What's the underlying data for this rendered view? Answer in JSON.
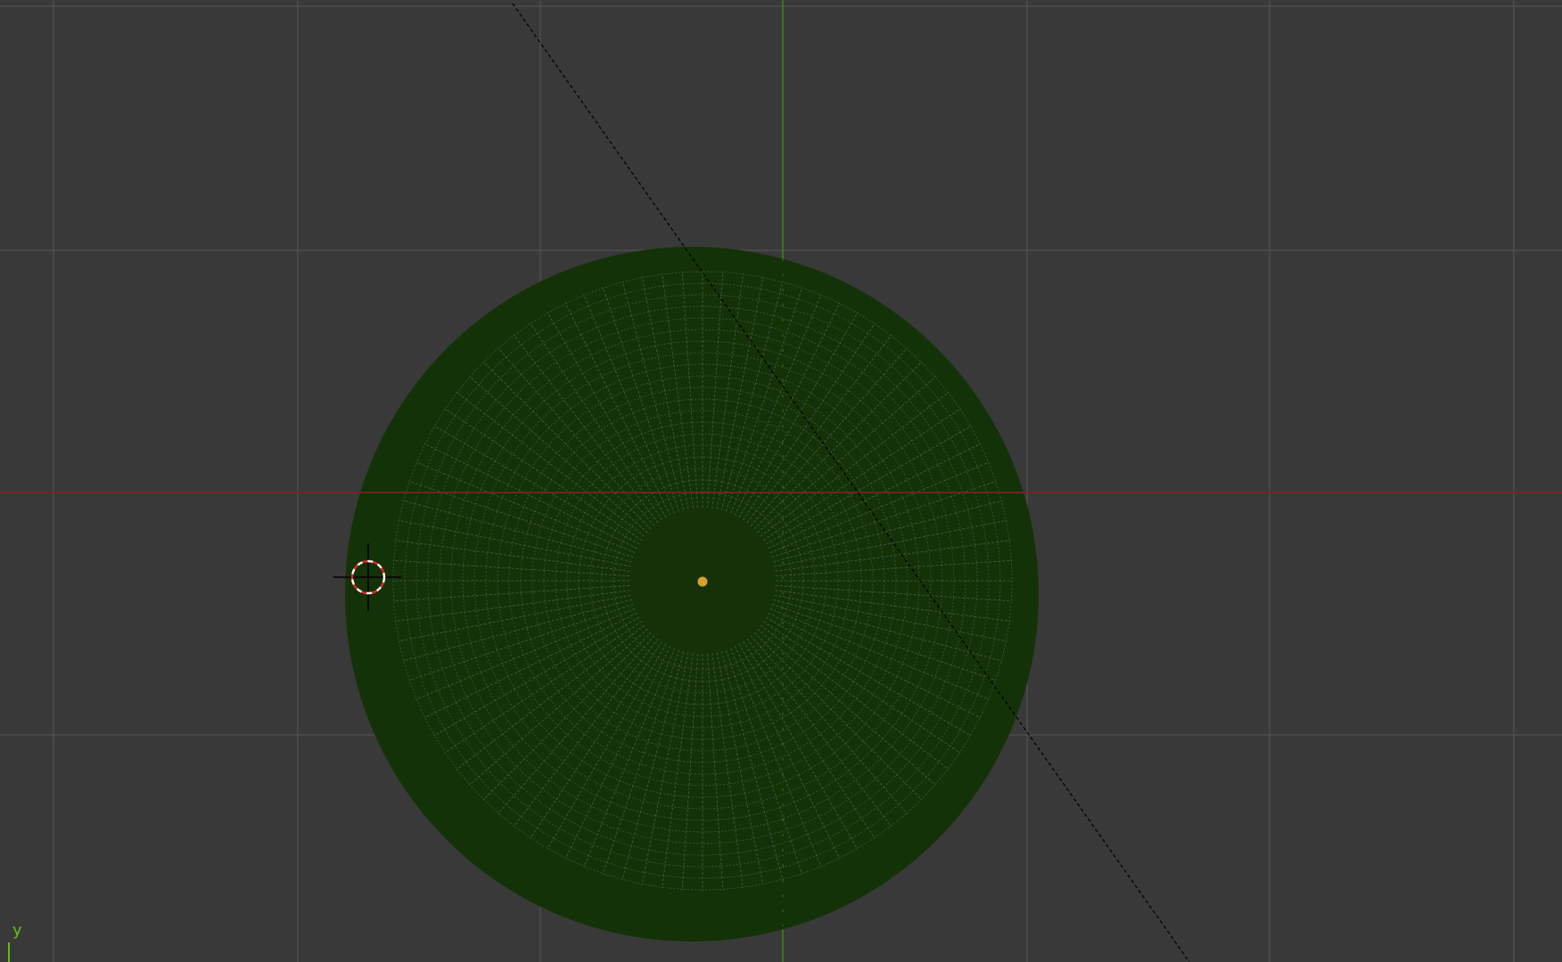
{
  "viewport": {
    "background": "#393939",
    "grid_color": "#505050",
    "x_axis_color": "#8a1f1f",
    "y_axis_color": "#3e8a19"
  },
  "mesh": {
    "fill": "#143208",
    "wire": "#58645a",
    "origin_dot": "#d9a02c"
  },
  "cursor_3d": {
    "ring_primary": "#d22a2a",
    "ring_secondary": "#ffffff",
    "crosshair": "#000000"
  },
  "axis_indicator": {
    "label": "y",
    "color": "#5fbf1a"
  },
  "icons": {
    "cursor": "3d-cursor-icon",
    "origin": "origin-dot-icon"
  }
}
